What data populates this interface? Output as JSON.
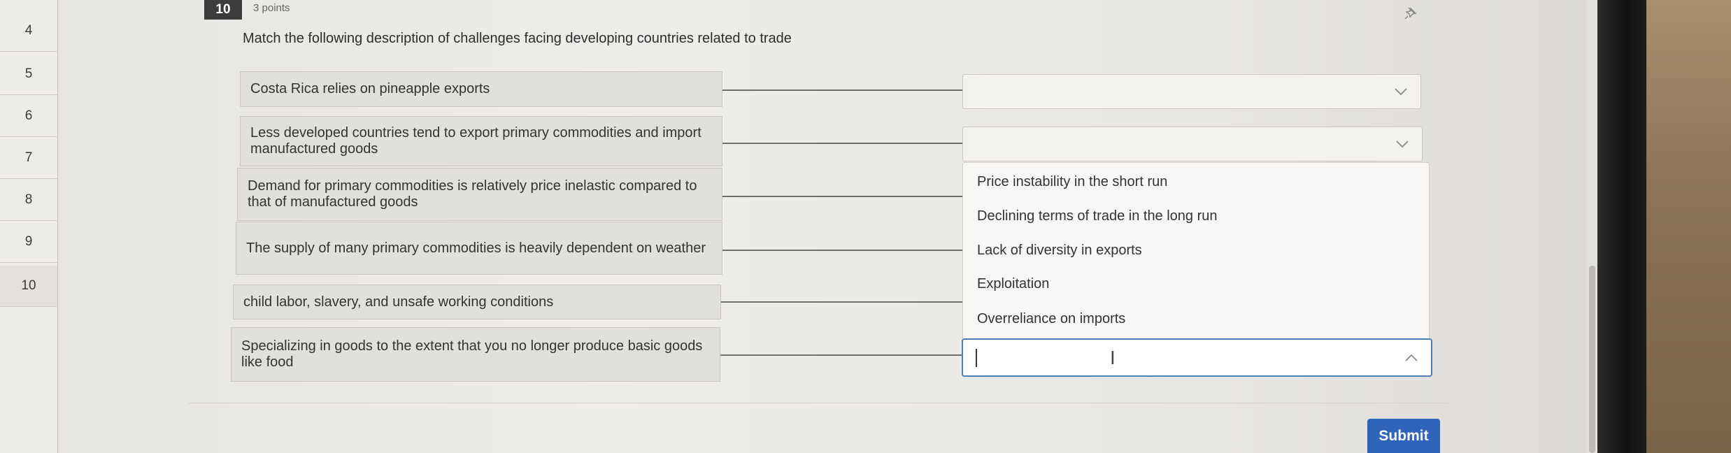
{
  "question_nav": [
    "4",
    "5",
    "6",
    "7",
    "8",
    "9",
    "10"
  ],
  "header": {
    "number": "10",
    "points": "3 points"
  },
  "question_text": "Match the following description of challenges facing developing countries related to trade",
  "prompts": [
    "Costa Rica relies on pineapple exports",
    "Less developed countries tend to export primary commodities and import manufactured goods",
    "Demand for primary commodities is relatively price inelastic compared to that of manufactured goods",
    "The supply of many primary commodities is heavily dependent on weather",
    "child labor, slavery, and unsafe working conditions",
    "Specializing in goods to the extent that you no longer produce basic goods like food"
  ],
  "selects": [
    {
      "value": ""
    },
    {
      "value": ""
    },
    {
      "value": ""
    }
  ],
  "dropdown_options": [
    "Price instability in the short run",
    "Declining terms of trade in the long run",
    "Lack of diversity in exports",
    "Exploitation",
    "Overreliance on imports"
  ],
  "submit_label": "Submit",
  "icons": {
    "pin": "pin-icon",
    "chevron_down": "chevron-down-icon",
    "chevron_up": "chevron-up-icon"
  },
  "colors": {
    "accent": "#2f64b8",
    "focus_border": "#4f7fb8",
    "header_badge": "#3c3c3c"
  }
}
